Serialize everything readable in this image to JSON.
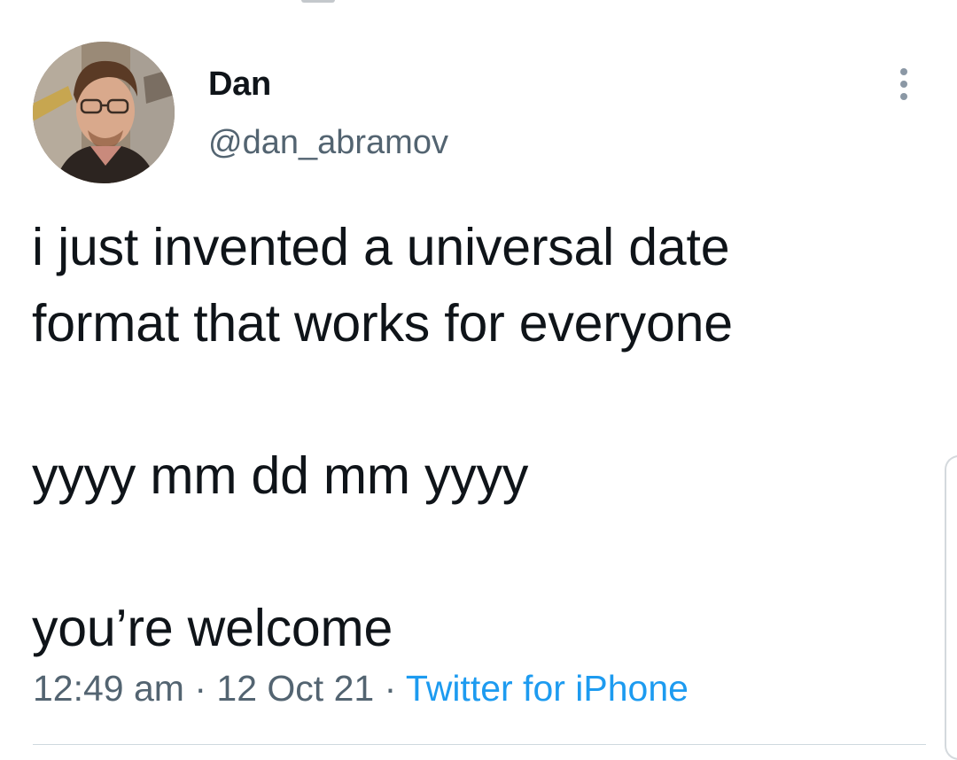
{
  "author": {
    "display_name": "Dan",
    "handle": "@dan_abramov",
    "avatar_icon": "profile-photo-icon"
  },
  "tweet": {
    "lines": [
      "i just invented a universal date",
      "format that works for everyone",
      "",
      "yyyy mm dd mm yyyy",
      "",
      "you’re welcome"
    ]
  },
  "meta": {
    "time": "12:49 am",
    "separator": "·",
    "date": "12 Oct 21",
    "source": "Twitter for iPhone"
  },
  "controls": {
    "more_icon": "more-options-icon"
  },
  "colors": {
    "text": "#0f1419",
    "secondary": "#536471",
    "link": "#1d9bf0",
    "divider": "#cfd9de"
  }
}
